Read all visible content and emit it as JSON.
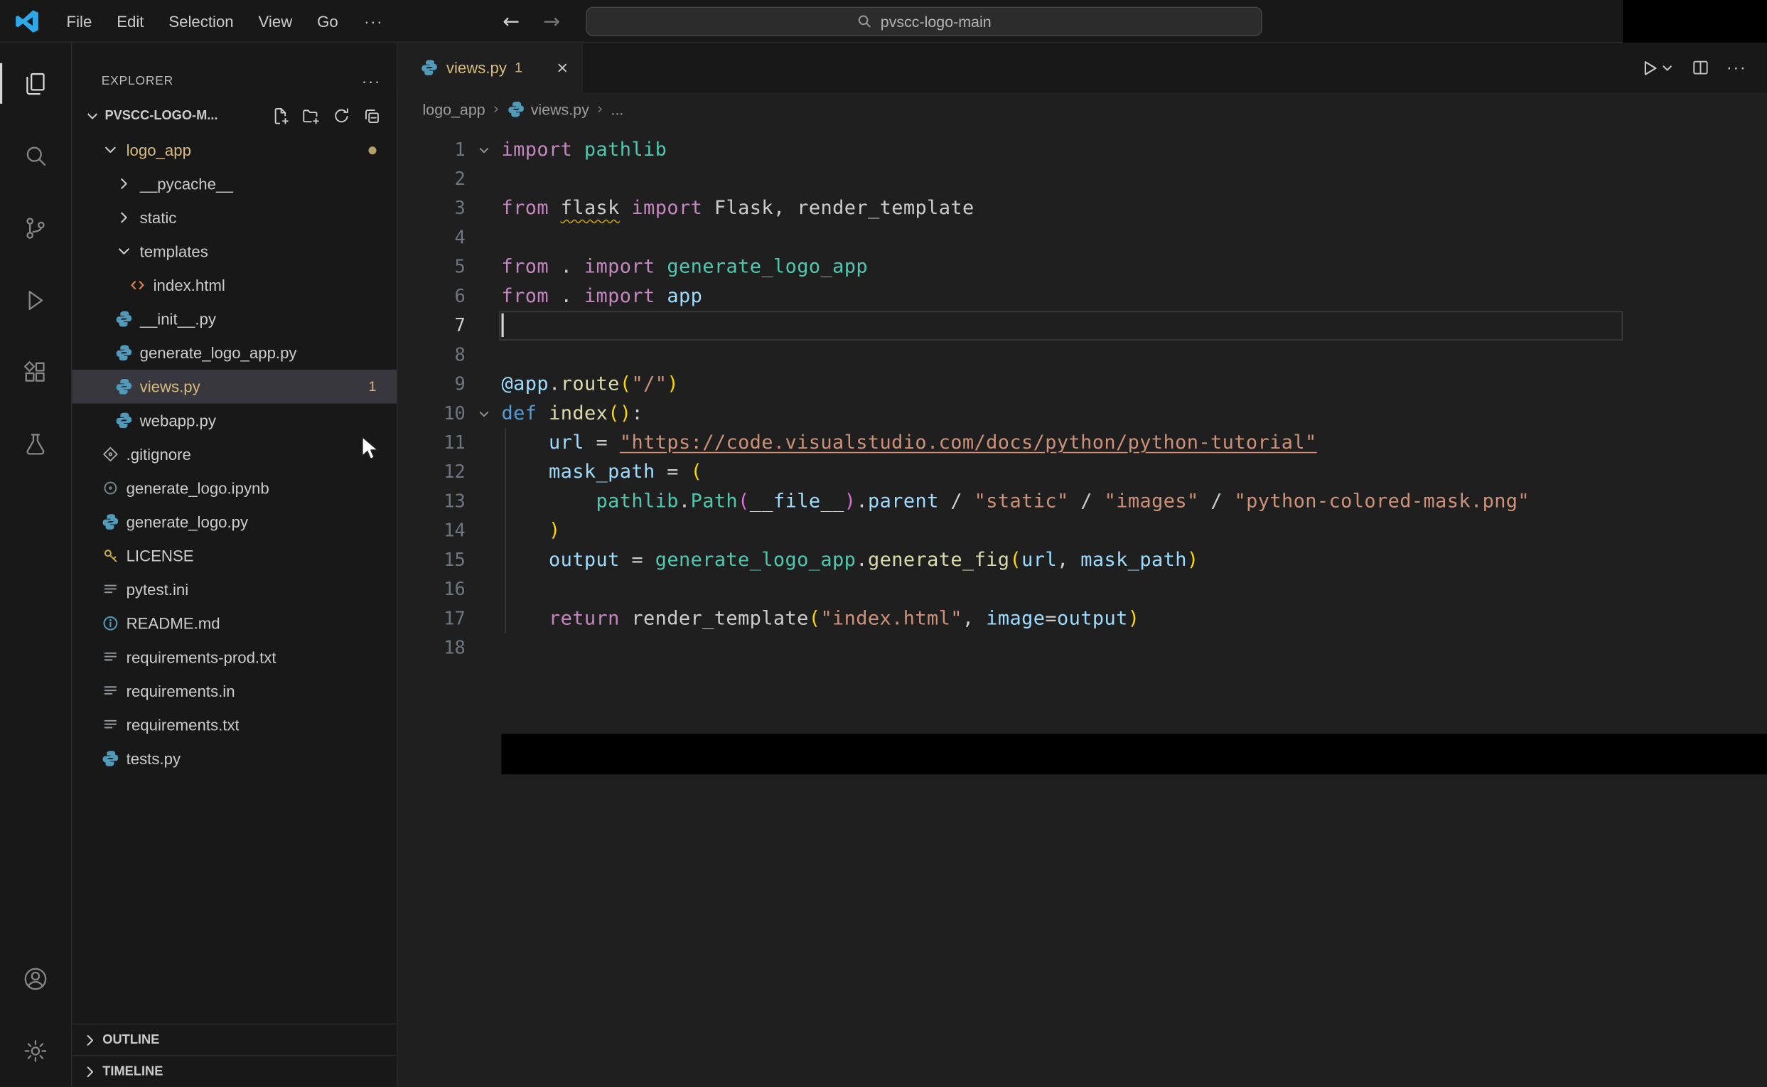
{
  "colors": {
    "accent": "#0078d4",
    "warning": "#d7ba7d",
    "selection_bg": "#37373d",
    "editor_bg": "#1f1f1f",
    "panel_bg": "#181818"
  },
  "title_bar": {
    "menus": [
      "File",
      "Edit",
      "Selection",
      "View",
      "Go"
    ],
    "more": "···",
    "back": "←",
    "forward": "→",
    "command_center": "pvscc-logo-main"
  },
  "activity_bar": {
    "top": [
      {
        "name": "explorer",
        "active": true
      },
      {
        "name": "search",
        "active": false
      },
      {
        "name": "source-control",
        "active": false
      },
      {
        "name": "run-debug",
        "active": false
      },
      {
        "name": "extensions",
        "active": false
      },
      {
        "name": "testing",
        "active": false
      }
    ],
    "bottom": [
      {
        "name": "account",
        "active": false
      },
      {
        "name": "settings",
        "active": false
      }
    ]
  },
  "sidebar": {
    "title": "EXPLORER",
    "header_more": "···",
    "section": {
      "label": "PVSCC-LOGO-M...",
      "actions": [
        "new-file",
        "new-folder",
        "refresh",
        "collapse-all"
      ]
    },
    "tree": [
      {
        "label": "logo_app",
        "depth": 0,
        "chevron": "down",
        "warn": true,
        "dot": true
      },
      {
        "label": "__pycache__",
        "depth": 1,
        "chevron": "right"
      },
      {
        "label": "static",
        "depth": 1,
        "chevron": "right"
      },
      {
        "label": "templates",
        "depth": 1,
        "chevron": "down"
      },
      {
        "label": "index.html",
        "depth": 2,
        "icon": "html"
      },
      {
        "label": "__init__.py",
        "depth": 1,
        "icon": "python"
      },
      {
        "label": "generate_logo_app.py",
        "depth": 1,
        "icon": "python"
      },
      {
        "label": "views.py",
        "depth": 1,
        "icon": "python",
        "selected": true,
        "warn": true,
        "badge": "1"
      },
      {
        "label": "webapp.py",
        "depth": 1,
        "icon": "python"
      },
      {
        "label": ".gitignore",
        "depth": 0,
        "icon": "git"
      },
      {
        "label": "generate_logo.ipynb",
        "depth": 0,
        "icon": "notebook"
      },
      {
        "label": "generate_logo.py",
        "depth": 0,
        "icon": "python"
      },
      {
        "label": "LICENSE",
        "depth": 0,
        "icon": "license"
      },
      {
        "label": "pytest.ini",
        "depth": 0,
        "icon": "config"
      },
      {
        "label": "README.md",
        "depth": 0,
        "icon": "info"
      },
      {
        "label": "requirements-prod.txt",
        "depth": 0,
        "icon": "text"
      },
      {
        "label": "requirements.in",
        "depth": 0,
        "icon": "text"
      },
      {
        "label": "requirements.txt",
        "depth": 0,
        "icon": "text"
      },
      {
        "label": "tests.py",
        "depth": 0,
        "icon": "python"
      }
    ],
    "panels": [
      "OUTLINE",
      "TIMELINE"
    ]
  },
  "editor": {
    "tab": {
      "icon": "python",
      "label": "views.py",
      "badge": "1",
      "close": "×"
    },
    "actions": {
      "run": "run",
      "run_dropdown": "chevron-down-s",
      "split": "split-editor",
      "more": "···"
    },
    "breadcrumbs": [
      {
        "label": "logo_app"
      },
      {
        "label": "views.py",
        "icon": "python"
      },
      {
        "label": "..."
      }
    ],
    "active_line": 7,
    "lines": [
      {
        "n": 1,
        "fold": true,
        "tokens": [
          {
            "t": "import",
            "c": "k"
          },
          {
            "t": " ",
            "c": "p"
          },
          {
            "t": "pathlib",
            "c": "t"
          }
        ]
      },
      {
        "n": 2,
        "tokens": []
      },
      {
        "n": 3,
        "tokens": [
          {
            "t": "from",
            "c": "k"
          },
          {
            "t": " ",
            "c": "p"
          },
          {
            "t": "flask",
            "c": "w"
          },
          {
            "t": " ",
            "c": "p"
          },
          {
            "t": "import",
            "c": "k"
          },
          {
            "t": " Flask, render_template",
            "c": "p"
          }
        ]
      },
      {
        "n": 4,
        "tokens": []
      },
      {
        "n": 5,
        "tokens": [
          {
            "t": "from",
            "c": "k"
          },
          {
            "t": " . ",
            "c": "p"
          },
          {
            "t": "import",
            "c": "k"
          },
          {
            "t": " ",
            "c": "p"
          },
          {
            "t": "generate_logo_app",
            "c": "t"
          }
        ]
      },
      {
        "n": 6,
        "tokens": [
          {
            "t": "from",
            "c": "k"
          },
          {
            "t": " . ",
            "c": "p"
          },
          {
            "t": "import",
            "c": "k"
          },
          {
            "t": " ",
            "c": "p"
          },
          {
            "t": "app",
            "c": "v"
          }
        ]
      },
      {
        "n": 7,
        "tokens": []
      },
      {
        "n": 8,
        "tokens": []
      },
      {
        "n": 9,
        "tokens": [
          {
            "t": "@app",
            "c": "v"
          },
          {
            "t": ".",
            "c": "p"
          },
          {
            "t": "route",
            "c": "f"
          },
          {
            "t": "(",
            "c": "b1"
          },
          {
            "t": "\"/\"",
            "c": "s"
          },
          {
            "t": ")",
            "c": "b1"
          }
        ]
      },
      {
        "n": 10,
        "fold": true,
        "tokens": [
          {
            "t": "def",
            "c": "d"
          },
          {
            "t": " ",
            "c": "p"
          },
          {
            "t": "index",
            "c": "f"
          },
          {
            "t": "(",
            "c": "b1"
          },
          {
            "t": ")",
            "c": "b1"
          },
          {
            "t": ":",
            "c": "p"
          }
        ]
      },
      {
        "n": 11,
        "tokens": [
          {
            "t": "    ",
            "c": "p"
          },
          {
            "t": "url",
            "c": "v"
          },
          {
            "t": " = ",
            "c": "p"
          },
          {
            "t": "\"https://code.visualstudio.com/docs/python/python-tutorial\"",
            "c": "su"
          }
        ]
      },
      {
        "n": 12,
        "tokens": [
          {
            "t": "    ",
            "c": "p"
          },
          {
            "t": "mask_path",
            "c": "v"
          },
          {
            "t": " = ",
            "c": "p"
          },
          {
            "t": "(",
            "c": "b1"
          }
        ]
      },
      {
        "n": 13,
        "tokens": [
          {
            "t": "        ",
            "c": "p"
          },
          {
            "t": "pathlib",
            "c": "t"
          },
          {
            "t": ".",
            "c": "p"
          },
          {
            "t": "Path",
            "c": "t"
          },
          {
            "t": "(",
            "c": "b2"
          },
          {
            "t": "__file__",
            "c": "v"
          },
          {
            "t": ")",
            "c": "b2"
          },
          {
            "t": ".",
            "c": "p"
          },
          {
            "t": "parent",
            "c": "v"
          },
          {
            "t": " / ",
            "c": "p"
          },
          {
            "t": "\"static\"",
            "c": "s"
          },
          {
            "t": " / ",
            "c": "p"
          },
          {
            "t": "\"images\"",
            "c": "s"
          },
          {
            "t": " / ",
            "c": "p"
          },
          {
            "t": "\"python-colored-mask.png\"",
            "c": "s"
          }
        ]
      },
      {
        "n": 14,
        "tokens": [
          {
            "t": "    ",
            "c": "p"
          },
          {
            "t": ")",
            "c": "b1"
          }
        ]
      },
      {
        "n": 15,
        "tokens": [
          {
            "t": "    ",
            "c": "p"
          },
          {
            "t": "output",
            "c": "v"
          },
          {
            "t": " = ",
            "c": "p"
          },
          {
            "t": "generate_logo_app",
            "c": "t"
          },
          {
            "t": ".",
            "c": "p"
          },
          {
            "t": "generate_fig",
            "c": "f"
          },
          {
            "t": "(",
            "c": "b1"
          },
          {
            "t": "url",
            "c": "v"
          },
          {
            "t": ", ",
            "c": "p"
          },
          {
            "t": "mask_path",
            "c": "v"
          },
          {
            "t": ")",
            "c": "b1"
          }
        ]
      },
      {
        "n": 16,
        "tokens": []
      },
      {
        "n": 17,
        "tokens": [
          {
            "t": "    ",
            "c": "p"
          },
          {
            "t": "return",
            "c": "k"
          },
          {
            "t": " render_template",
            "c": "p"
          },
          {
            "t": "(",
            "c": "b1"
          },
          {
            "t": "\"index.html\"",
            "c": "s"
          },
          {
            "t": ", ",
            "c": "p"
          },
          {
            "t": "image",
            "c": "v"
          },
          {
            "t": "=",
            "c": "p"
          },
          {
            "t": "output",
            "c": "v"
          },
          {
            "t": ")",
            "c": "b1"
          }
        ]
      },
      {
        "n": 18,
        "tokens": []
      }
    ]
  }
}
